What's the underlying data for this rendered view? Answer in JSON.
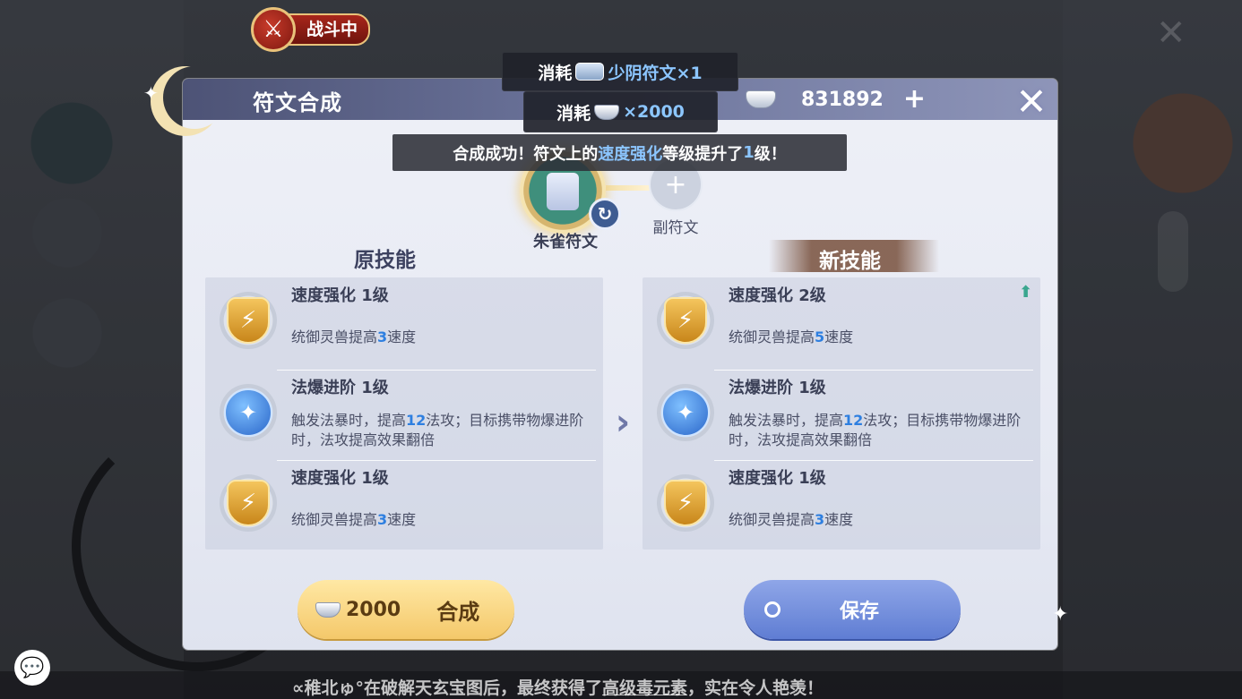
{
  "battle": {
    "label": "战斗中",
    "icon": "crossed-swords-icon"
  },
  "dialog": {
    "title": "符文合成",
    "currency": {
      "amount": "831892",
      "plus": "+"
    },
    "close": "✕"
  },
  "cost": {
    "line1_prefix": "消耗",
    "line1_item": "少阴符文×1",
    "line2_prefix": "消耗",
    "line2_amount": "×2000"
  },
  "success": {
    "prefix": "合成成功！符文上的",
    "skill": "速度强化",
    "suffix_a": "等级提升了",
    "level": "1",
    "suffix_b": "级！"
  },
  "runes": {
    "main_label": "朱雀符文",
    "sub_label": "副符文",
    "sub_plus": "+"
  },
  "old_skills": {
    "heading": "原技能",
    "rows": [
      {
        "name": "速度强化  1级",
        "desc_pre": "统御灵兽提高",
        "num": "3",
        "desc_post": "速度",
        "icon": "speed-shield-icon"
      },
      {
        "name": "法爆进阶  1级",
        "desc_pre": "触发法暴时，提高",
        "num": "12",
        "desc_post": "法攻；目标携带物爆进阶时，法攻提高效果翻倍",
        "icon": "magic-orb-icon"
      },
      {
        "name": "速度强化  1级",
        "desc_pre": "统御灵兽提高",
        "num": "3",
        "desc_post": "速度",
        "icon": "speed-shield-icon"
      }
    ]
  },
  "new_skills": {
    "heading": "新技能",
    "rows": [
      {
        "name": "速度强化  2级",
        "desc_pre": "统御灵兽提高",
        "num": "5",
        "desc_post": "速度",
        "icon": "speed-shield-icon"
      },
      {
        "name": "法爆进阶  1级",
        "desc_pre": "触发法暴时，提高",
        "num": "12",
        "desc_post": "法攻；目标携带物爆进阶时，法攻提高效果翻倍",
        "icon": "magic-orb-icon"
      },
      {
        "name": "速度强化  1级",
        "desc_pre": "统御灵兽提高",
        "num": "3",
        "desc_post": "速度",
        "icon": "speed-shield-icon"
      }
    ]
  },
  "buttons": {
    "synth_cost": "2000",
    "synth_label": "合成",
    "save_label": "保存"
  },
  "ticker": {
    "pre": "∝稚北ゅ°在破解天玄宝图后，最终获得了",
    "item": "高级毒元素",
    "post": "，实在令人艳羡！"
  },
  "colors": {
    "accent_blue": "#2e7fe0",
    "highlight": "#8cc6ff",
    "gold": "#f4c86a"
  }
}
